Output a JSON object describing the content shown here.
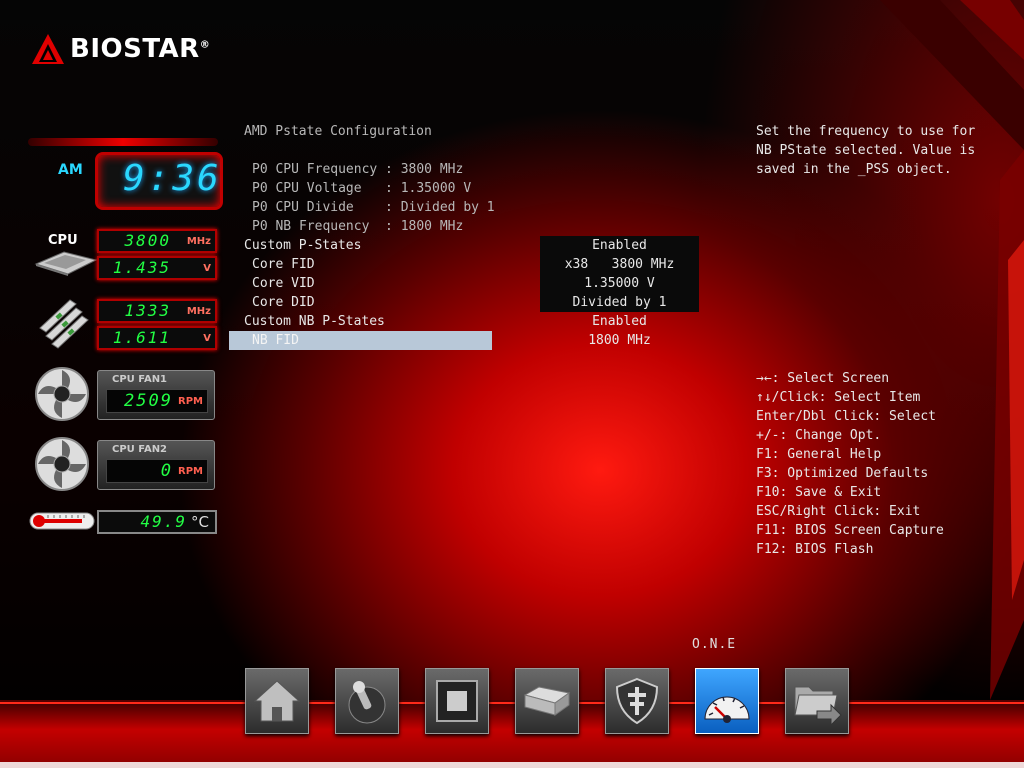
{
  "brand": {
    "name": "BIOSTAR",
    "mark": "®"
  },
  "clock": {
    "ampm": "AM",
    "time": "9:36"
  },
  "hw": {
    "cpu_label": "CPU",
    "cpu_freq": {
      "value": "3800",
      "unit": "MHz"
    },
    "cpu_volt": {
      "value": "1.435",
      "unit": "V"
    },
    "mem_freq": {
      "value": "1333",
      "unit": "MHz"
    },
    "mem_volt": {
      "value": "1.611",
      "unit": "V"
    },
    "fan1": {
      "title": "CPU FAN1",
      "value": "2509",
      "unit": "RPM"
    },
    "fan2": {
      "title": "CPU FAN2",
      "value": "0",
      "unit": "RPM"
    },
    "temp": {
      "value": "49.9",
      "unit": "°C"
    }
  },
  "menu": {
    "title": "AMD Pstate Configuration",
    "info": [
      "P0 CPU Frequency : 3800 MHz",
      "P0 CPU Voltage   : 1.35000 V",
      "P0 CPU Divide    : Divided by 1",
      "P0 NB Frequency  : 1800 MHz"
    ],
    "items": [
      {
        "label": "Custom P-States",
        "value": "Enabled"
      },
      {
        "label": "Core FID",
        "value": "x38   3800 MHz"
      },
      {
        "label": "Core VID",
        "value": "1.35000 V"
      },
      {
        "label": "Core DID",
        "value": "Divided by 1"
      },
      {
        "label": "Custom NB P-States",
        "value": "Enabled"
      },
      {
        "label": "NB FID",
        "value": "1800 MHz"
      }
    ]
  },
  "help": {
    "description": [
      "Set the frequency to use for",
      "NB PState selected. Value is",
      "saved in the _PSS object."
    ],
    "keys": [
      "→←: Select Screen",
      "↑↓/Click: Select Item",
      "Enter/Dbl Click: Select",
      "+/-: Change Opt.",
      "F1: General Help",
      "F3: Optimized Defaults",
      "F10: Save & Exit",
      "ESC/Right Click: Exit",
      "F11: BIOS Screen Capture",
      "F12: BIOS Flash"
    ]
  },
  "nav": {
    "active_label": "O.N.E",
    "buttons": [
      {
        "icon": "home-icon"
      },
      {
        "icon": "joystick-icon"
      },
      {
        "icon": "chip-icon"
      },
      {
        "icon": "drive-icon"
      },
      {
        "icon": "shield-icon"
      },
      {
        "icon": "speedometer-icon"
      },
      {
        "icon": "folder-exit-icon"
      }
    ]
  }
}
